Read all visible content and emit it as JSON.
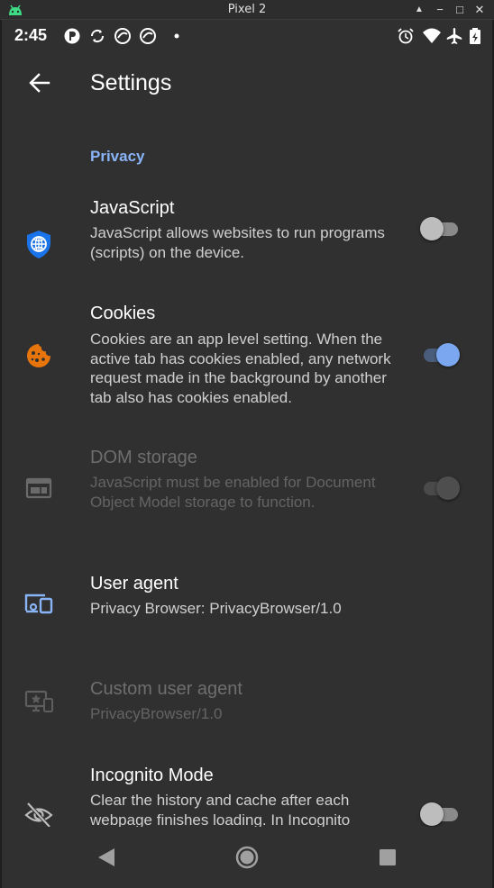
{
  "window": {
    "title": "Pixel 2",
    "minimize": "▲",
    "restore": "−",
    "maximize": "□",
    "close": "✕"
  },
  "status_bar": {
    "time": "2:45"
  },
  "app_bar": {
    "title": "Settings"
  },
  "category": {
    "label": "Privacy"
  },
  "prefs": [
    {
      "title": "JavaScript",
      "summary": "JavaScript allows websites to run programs (scripts) on the device.",
      "icon": "globe-shield-icon",
      "switch": false,
      "enabled": true
    },
    {
      "title": "Cookies",
      "summary": "Cookies are an app level setting. When the active tab has cookies enabled, any network request made in the background by another tab also has cookies enabled.",
      "icon": "cookie-icon",
      "switch": true,
      "enabled": true
    },
    {
      "title": "DOM storage",
      "summary": "JavaScript must be enabled for Document Object Model storage to function.",
      "icon": "dom-storage-icon",
      "switch": true,
      "enabled": false
    },
    {
      "title": "User agent",
      "summary": "Privacy Browser: PrivacyBrowser/1.0",
      "icon": "user-agent-devices-icon",
      "enabled": true
    },
    {
      "title": "Custom user agent",
      "summary": "PrivacyBrowser/1.0",
      "icon": "custom-user-agent-icon",
      "enabled": false
    },
    {
      "title": "Incognito Mode",
      "summary": "Clear the history and cache after each webpage finishes loading. In Incognito",
      "icon": "incognito-eye-off-icon",
      "switch": false,
      "enabled": true
    }
  ],
  "colors": {
    "accent": "#8ab4f8",
    "shield": "#1a73e8",
    "cookie": "#e8740c",
    "background": "#303030"
  }
}
